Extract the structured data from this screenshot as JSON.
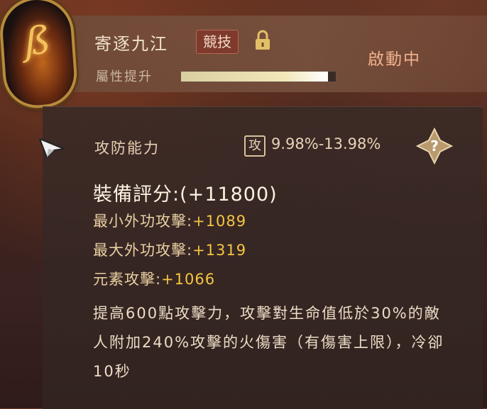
{
  "skill": {
    "name": "寄逐九江",
    "tag": "競技",
    "status": "啟動中",
    "attribute_label": "屬性提升",
    "progress": 0.95,
    "icons": {
      "emblem": "skill-emblem-icon",
      "lock": "lock-icon"
    }
  },
  "ability": {
    "label": "攻防能力",
    "type_icon_text": "攻",
    "range": "9.98%-13.98%",
    "help_icon": "question-icon"
  },
  "score": {
    "label": "裝備評分",
    "separator": ":",
    "value": "(+11800)"
  },
  "stats": [
    {
      "label": "最小外功攻擊",
      "sep": ":",
      "value": "+1089"
    },
    {
      "label": "最大外功攻擊",
      "sep": ":",
      "value": "+1319"
    },
    {
      "label": "元素攻擊",
      "sep": ":",
      "value": "+1066"
    }
  ],
  "description": "提高600點攻擊力，攻擊對生命值低於30%的敵人附加240%攻擊的火傷害（有傷害上限），冷卻10秒",
  "colors": {
    "accent": "#f4c542",
    "status": "#f0b28c",
    "badge": "#7e3a2c"
  }
}
